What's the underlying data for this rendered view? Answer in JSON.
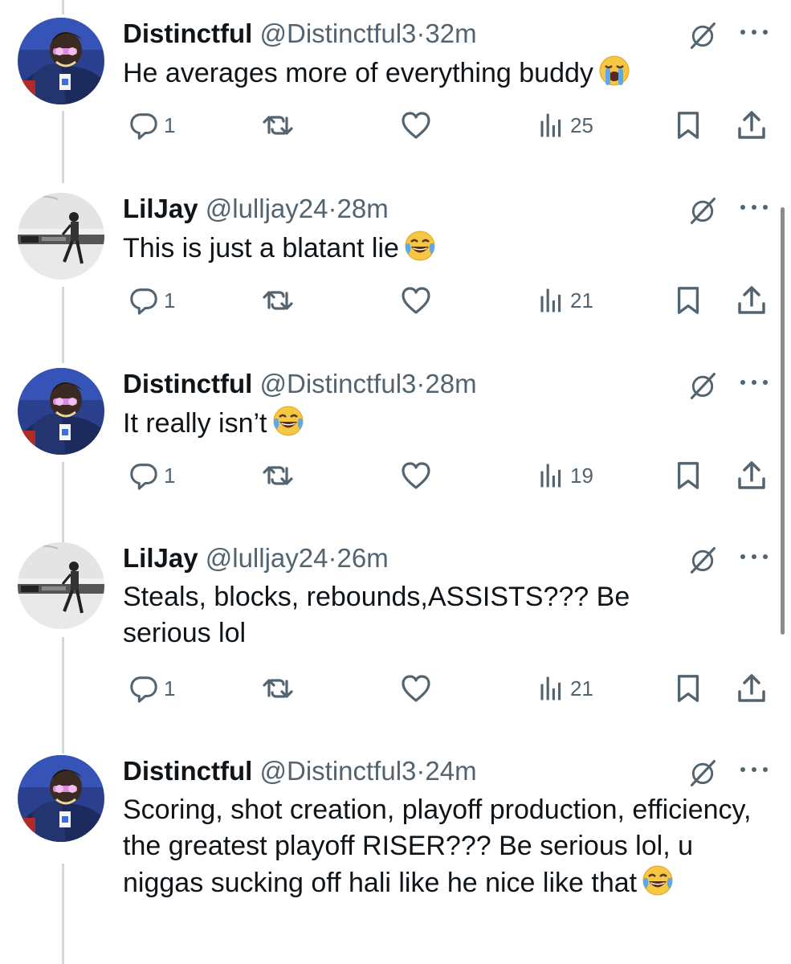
{
  "tweets": [
    {
      "name": "Distinctful",
      "handle": "@Distinctful3",
      "time": "32m",
      "text": "He averages more of everything buddy",
      "emoji": "loudly-crying-face",
      "replies": "1",
      "views": "25",
      "avatar": "distinctful"
    },
    {
      "name": "LilJay",
      "handle": "@lulljay24",
      "time": "28m",
      "text": "This is just a blatant lie",
      "emoji": "face-with-tears-of-joy",
      "replies": "1",
      "views": "21",
      "avatar": "liljay"
    },
    {
      "name": "Distinctful",
      "handle": "@Distinctful3",
      "time": "28m",
      "text": "It really isn’t",
      "emoji": "face-with-tears-of-joy",
      "replies": "1",
      "views": "19",
      "avatar": "distinctful"
    },
    {
      "name": "LilJay",
      "handle": "@lulljay24",
      "time": "26m",
      "text": "Steals, blocks, rebounds,ASSISTS??? Be serious lol",
      "emoji": "",
      "replies": "1",
      "views": "21",
      "avatar": "liljay"
    },
    {
      "name": "Distinctful",
      "handle": "@Distinctful3",
      "time": "24m",
      "text": "Scoring, shot creation, playoff production, efficiency, the greatest playoff RISER??? Be serious lol, u niggas sucking off hali like he nice like that",
      "emoji": "face-with-tears-of-joy",
      "replies": "",
      "views": "",
      "avatar": "distinctful"
    }
  ],
  "separator": "·",
  "colors": {
    "text": "#0f1419",
    "secondary": "#536471",
    "thread_line": "#cfd9de"
  }
}
